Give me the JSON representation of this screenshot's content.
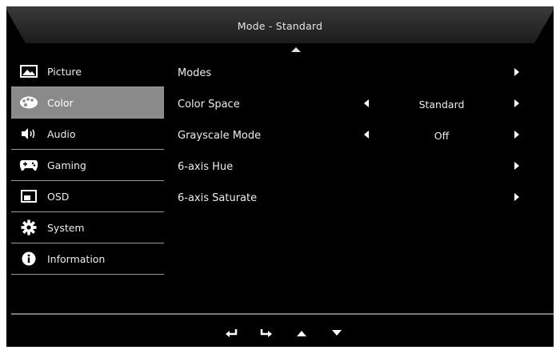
{
  "title": "Mode - Standard",
  "sidebar": {
    "items": [
      {
        "label": "Picture",
        "icon": "picture-icon"
      },
      {
        "label": "Color",
        "icon": "palette-icon",
        "selected": true
      },
      {
        "label": "Audio",
        "icon": "speaker-icon"
      },
      {
        "label": "Gaming",
        "icon": "gamepad-icon"
      },
      {
        "label": "OSD",
        "icon": "osd-window-icon"
      },
      {
        "label": "System",
        "icon": "gear-icon"
      },
      {
        "label": "Information",
        "icon": "info-icon"
      }
    ]
  },
  "content": {
    "rows": [
      {
        "label": "Modes",
        "value": ""
      },
      {
        "label": "Color Space",
        "value": "Standard"
      },
      {
        "label": "Grayscale Mode",
        "value": "Off"
      },
      {
        "label": "6-axis Hue",
        "value": ""
      },
      {
        "label": "6-axis Saturate",
        "value": ""
      }
    ]
  },
  "bottom_bar": {
    "icons": [
      "return-icon",
      "enter-icon",
      "up-arrow-icon",
      "down-arrow-icon"
    ]
  },
  "colors": {
    "background": "#000000",
    "selected_item": "#8a8a8a",
    "text": "#ececec",
    "divider": "#9a9a9a"
  }
}
